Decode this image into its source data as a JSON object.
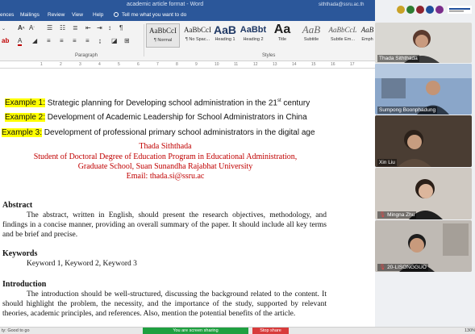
{
  "window": {
    "doc_title": "academic article format - Word",
    "account": "siththada@ssru.ac.th"
  },
  "menu": {
    "tabs": [
      "ences",
      "Mailings",
      "Review",
      "View",
      "Help"
    ],
    "tell_me": "Tell me what you want to do"
  },
  "ribbon": {
    "font_size": "",
    "paragraph_label": "Paragraph",
    "styles_label": "Styles",
    "styles": [
      {
        "sample": "AaBbCcI",
        "name": "¶ Normal",
        "selected": true
      },
      {
        "sample": "AaBbCcI",
        "name": "¶ No Spac..."
      },
      {
        "sample": "AaB",
        "name": "Heading 1"
      },
      {
        "sample": "AaBbt",
        "name": "Heading 2"
      },
      {
        "sample": "Aa",
        "name": "Title"
      },
      {
        "sample": "AaB",
        "name": "Subtitle"
      },
      {
        "sample": "AaBbCcL",
        "name": "Subtle Em..."
      },
      {
        "sample": "AaB",
        "name": "Emph"
      }
    ]
  },
  "ruler": {
    "numbers": [
      "1",
      "2",
      "3",
      "4",
      "5",
      "6",
      "7",
      "8",
      "9",
      "10",
      "11",
      "12",
      "13",
      "14",
      "15",
      "16",
      "17"
    ]
  },
  "document": {
    "examples": [
      {
        "tag": "Example 1:",
        "text": " Strategic planning for Developing school administration in the 21",
        "sup": "st",
        "tail": " century"
      },
      {
        "tag": "Example 2:",
        "text": " Development of Academic Leadership for School Administrators in China",
        "sup": "",
        "tail": ""
      },
      {
        "tag": "Example 3:",
        "text": " Development of professional primary school administrators in the digital age",
        "sup": "",
        "tail": ""
      }
    ],
    "author": "Thada Siththada",
    "affiliation_line1": "Student of Doctoral Degree of Education Program in Educational Administration,",
    "affiliation_line2": "Graduate School, Suan Sunandha Rajabhat University",
    "email": "Email: thada.si@ssru.ac",
    "abstract_heading": "Abstract",
    "abstract_body": "The abstract, written in English, should present the research objectives, methodology, and findings in a concise manner, providing an overall summary of the paper. It should include all key terms and be brief and precise.",
    "keywords_heading": "Keywords",
    "keywords_body": "Keyword 1, Keyword 2, Keyword 3",
    "intro_heading": "Introduction",
    "intro_body": "The introduction should be well-structured, discussing the background related to the content. It should highlight the problem, the necessity, and the importance of the study, supported by relevant theories, academic principles, and references. Also, mention the potential benefits of the article."
  },
  "status_bar": {
    "left": "ty: Good to go",
    "sharing": "You are screen sharing",
    "stop_share": "Stop share",
    "zoom": "130%"
  },
  "participants": [
    {
      "name": "Thada Siththada",
      "bg": "#d9d7d2",
      "muted": false
    },
    {
      "name": "Sumpong Boonphadung",
      "bg": "#8aa6c9",
      "muted": false
    },
    {
      "name": "Xin Liu",
      "bg": "#4a3d33",
      "muted": false
    },
    {
      "name": "Mingna Zhu",
      "bg": "#cfc9c2",
      "muted": true
    },
    {
      "name": "20-LISONGGUO",
      "bg": "#bfbab4",
      "muted": true
    }
  ],
  "colors": {
    "word_blue": "#2b579a",
    "highlight": "#ffff00",
    "author_red": "#c00000",
    "share_green": "#1fa040",
    "stop_red": "#d83b3b"
  }
}
